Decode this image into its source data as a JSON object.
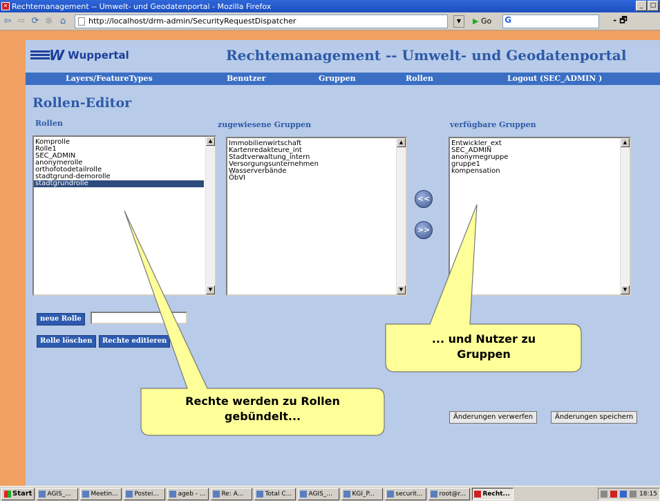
{
  "window": {
    "title": "Rechtemanagement -- Umwelt- und Geodatenportal - Mozilla Firefox"
  },
  "browser": {
    "url": "http://localhost/drm-admin/SecurityRequestDispatcher",
    "go_label": "Go"
  },
  "header": {
    "logo_text": "Wuppertal",
    "title": "Rechtemanagement -- Umwelt- und Geodatenportal"
  },
  "menu": {
    "items": [
      "Layers/FeatureTypes",
      "Benutzer",
      "Gruppen",
      "Rollen",
      "Logout (SEC_ADMIN )"
    ]
  },
  "editor": {
    "title": "Rollen-Editor",
    "roles_label": "Rollen",
    "assigned_label": "zugewiesene Gruppen",
    "available_label": "verfügbare Gruppen",
    "roles": [
      "Komprolle",
      "Rolle1",
      "SEC_ADMIN",
      "anonymerolle",
      "orthofotodetailrolle",
      "stadtgrund-demorolle",
      "stadtgrundrolle"
    ],
    "selected_role": "stadtgrundrolle",
    "assigned_groups": [
      "Immobilienwirtschaft",
      "Kartenredakteure_int",
      "Stadtverwaltung_intern",
      "Versorgungsunternehmen",
      "Wasserverbände",
      "ÖbVI"
    ],
    "available_groups": [
      "Entwickler_ext",
      "SEC_ADMIN",
      "anonymegruppe",
      "gruppe1",
      "kompensation"
    ],
    "move_left_symbol": "<<",
    "move_right_symbol": ">>",
    "new_role_label": "neue Rolle",
    "delete_role_label": "Rolle löschen",
    "edit_rights_label": "Rechte editieren",
    "discard_label": "Änderungen verwerfen",
    "save_label": "Änderungen speichern"
  },
  "callouts": {
    "left": [
      "Rechte werden zu Rollen",
      "gebündelt..."
    ],
    "right": [
      "... und Nutzer zu",
      "Gruppen"
    ]
  },
  "taskbar": {
    "start_label": "Start",
    "items": [
      "AGIS_...",
      "Meetin...",
      "Postei...",
      "ageb - ...",
      "Re: A...",
      "Total C...",
      "AGIS_...",
      "KGI_P...",
      "securit...",
      "root@r...",
      "Recht..."
    ],
    "active_index": 10,
    "clock": "18:15"
  }
}
